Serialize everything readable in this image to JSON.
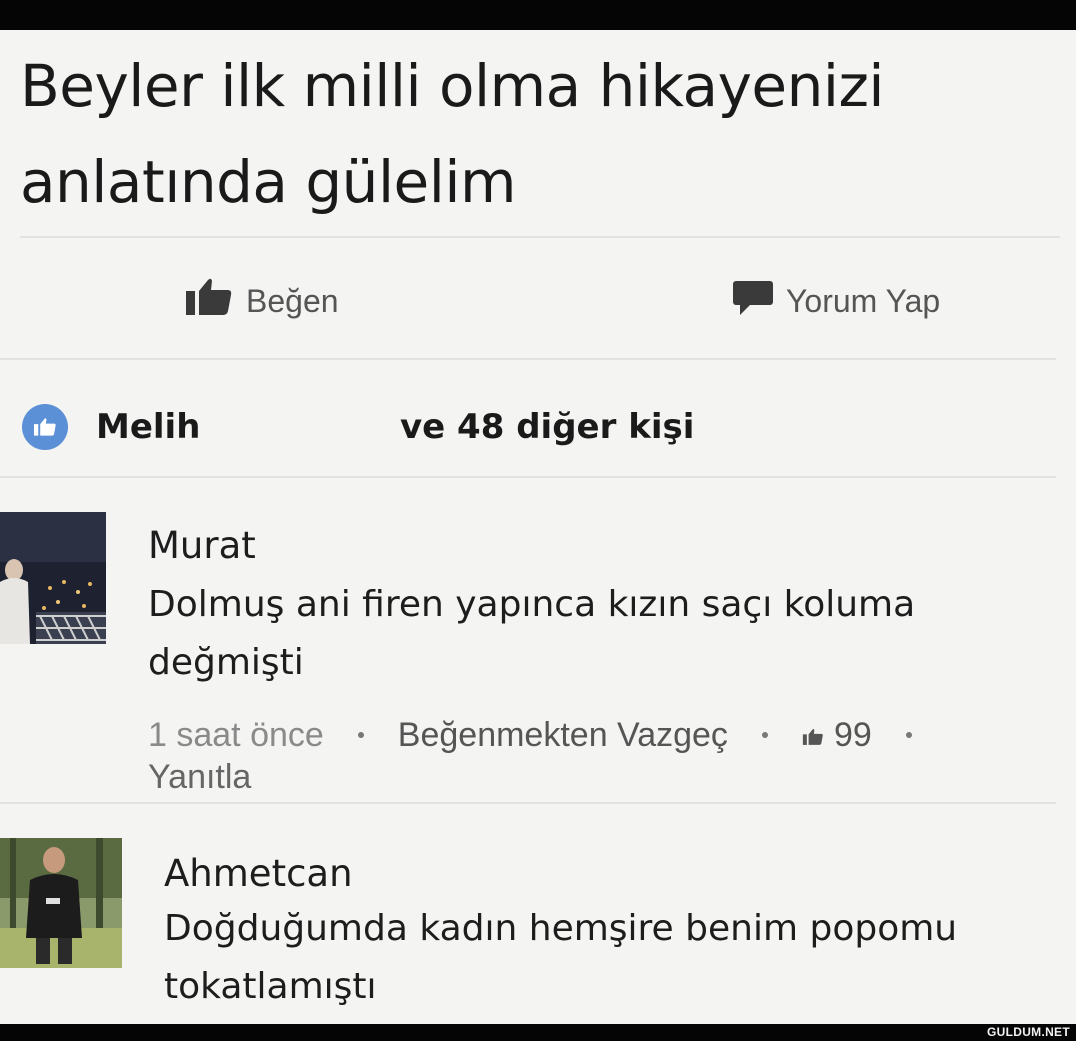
{
  "post": {
    "text_line1": "Beyler ilk milli olma hikayenizi",
    "text_line2": "anlatında gülelim"
  },
  "actions": {
    "like_label": "Beğen",
    "comment_label": "Yorum Yap"
  },
  "likes": {
    "first_name": "Melih",
    "others": "ve 48 diğer kişi"
  },
  "comments": [
    {
      "author": "Murat",
      "text_line1": "Dolmuş ani firen yapınca kızın saçı koluma",
      "text_line2": "değmişti",
      "time": "1 saat önce",
      "unlike_label": "Beğenmekten Vazgeç",
      "like_count": "99",
      "reply_label": "Yanıtla"
    },
    {
      "author": "Ahmetcan",
      "text_line1": "Doğduğumda kadın hemşire benim popomu",
      "text_line2": "tokatlamıştı"
    }
  ],
  "watermark": "GULDUM.NET",
  "colors": {
    "background": "#f4f4f2",
    "like_badge": "#5b8fd6",
    "text": "#1d1d1d",
    "muted": "#8a8a8a"
  },
  "icons": {
    "like": "thumbs-up-icon",
    "comment": "speech-bubble-icon",
    "likes_badge": "thumbs-up-circle-icon"
  }
}
